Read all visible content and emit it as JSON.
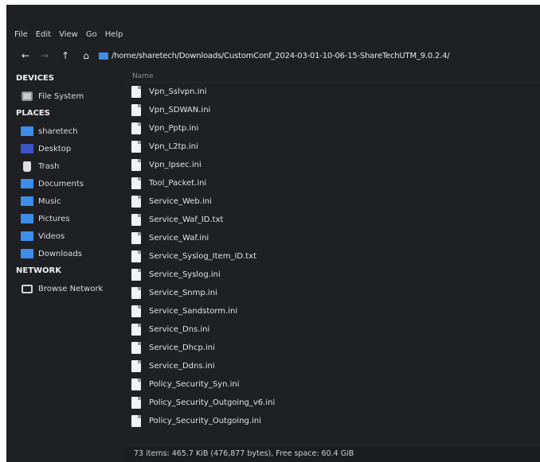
{
  "menu": [
    "File",
    "Edit",
    "View",
    "Go",
    "Help"
  ],
  "toolbar": {
    "path": "/home/sharetech/Downloads/CustomConf_2024-03-01-10-06-15-ShareTechUTM_9.0.2.4/"
  },
  "sidebar": {
    "devices_label": "DEVICES",
    "devices": [
      {
        "label": "File System",
        "icon": "drive-icon"
      }
    ],
    "places_label": "PLACES",
    "places": [
      {
        "label": "sharetech",
        "icon": "home-folder-icon"
      },
      {
        "label": "Desktop",
        "icon": "desktop-icon"
      },
      {
        "label": "Trash",
        "icon": "trash-icon"
      },
      {
        "label": "Documents",
        "icon": "folder-icon"
      },
      {
        "label": "Music",
        "icon": "folder-icon"
      },
      {
        "label": "Pictures",
        "icon": "folder-icon"
      },
      {
        "label": "Videos",
        "icon": "folder-icon"
      },
      {
        "label": "Downloads",
        "icon": "folder-icon"
      }
    ],
    "network_label": "NETWORK",
    "network": [
      {
        "label": "Browse Network",
        "icon": "network-icon"
      }
    ]
  },
  "files": {
    "column_name": "Name",
    "items": [
      "Vpn_Sslvpn.ini",
      "Vpn_SDWAN.ini",
      "Vpn_Pptp.ini",
      "Vpn_L2tp.ini",
      "Vpn_Ipsec.ini",
      "Tool_Packet.ini",
      "Service_Web.ini",
      "Service_Waf_ID.txt",
      "Service_Waf.ini",
      "Service_Syslog_Item_ID.txt",
      "Service_Syslog.ini",
      "Service_Snmp.ini",
      "Service_Sandstorm.ini",
      "Service_Dns.ini",
      "Service_Dhcp.ini",
      "Service_Ddns.ini",
      "Policy_Security_Syn.ini",
      "Policy_Security_Outgoing_v6.ini",
      "Policy_Security_Outgoing.ini"
    ]
  },
  "status": {
    "text": "73 items: 465.7 KiB (476,877 bytes), Free space: 60.4 GiB"
  },
  "colors": {
    "window_bg": "#1f2024",
    "folder_blue": "#3d8ee8",
    "desktop_blue": "#3b55c6"
  }
}
